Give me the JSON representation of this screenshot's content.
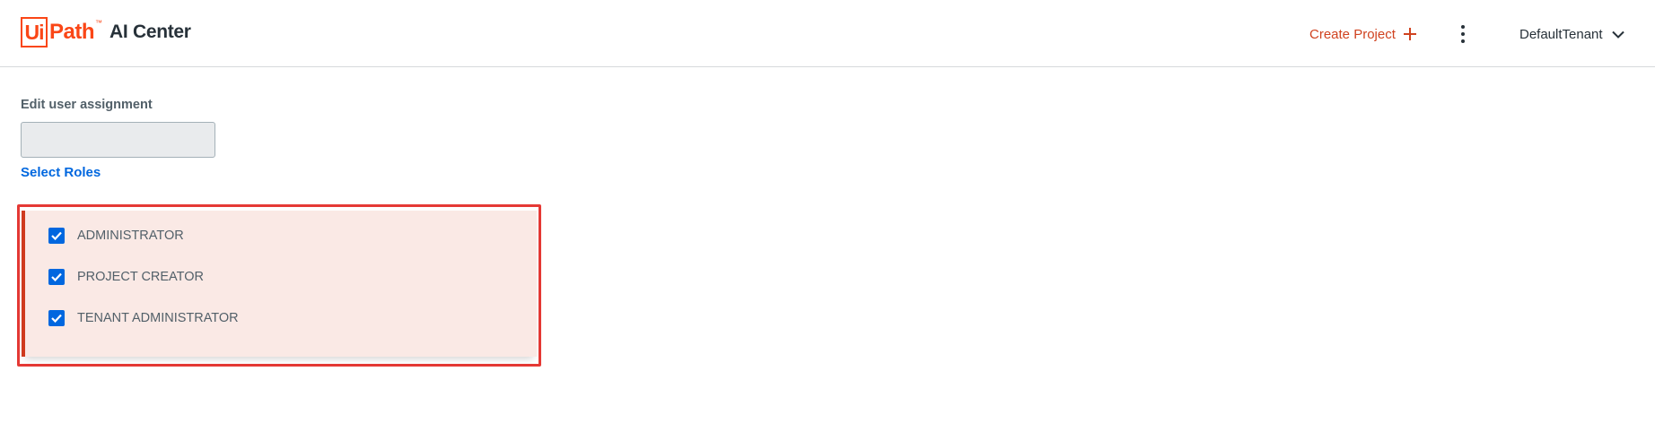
{
  "header": {
    "logo_box_text": "Ui",
    "logo_word": "Path",
    "logo_tm": "™",
    "product_name": "AI Center",
    "create_project_label": "Create Project",
    "tenant_name": "DefaultTenant"
  },
  "form": {
    "title": "Edit user assignment",
    "user_field_value": "",
    "select_roles_label": "Select Roles"
  },
  "roles": [
    {
      "label": "ADMINISTRATOR",
      "checked": true
    },
    {
      "label": "PROJECT CREATOR",
      "checked": true
    },
    {
      "label": "TENANT ADMINISTRATOR",
      "checked": true
    }
  ],
  "colors": {
    "brand": "#fa4616",
    "accent": "#0067df",
    "highlight_outline": "#e53935"
  },
  "icons": {
    "create": "plus-icon",
    "more": "kebab-menu-icon",
    "tenant_dropdown": "chevron-down-icon",
    "checkbox": "checkmark-icon"
  }
}
